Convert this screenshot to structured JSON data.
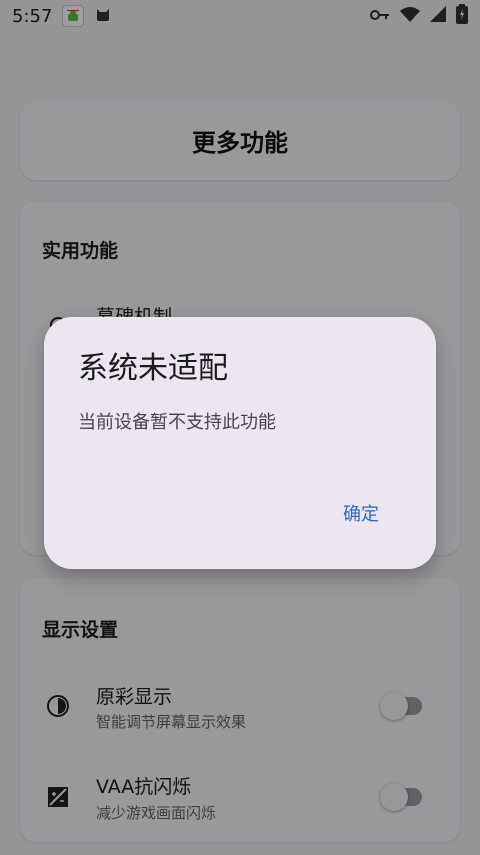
{
  "status_bar": {
    "time": "5:57"
  },
  "page": {
    "title": "更多功能"
  },
  "practical_section": {
    "title": "实用功能",
    "items": [
      {
        "label": "募碑机制",
        "icon": "person-outline-icon"
      }
    ]
  },
  "display_section": {
    "title": "显示设置",
    "items": [
      {
        "label": "原彩显示",
        "subtitle": "智能调节屏幕显示效果",
        "icon": "contrast-icon",
        "enabled": false
      },
      {
        "label": "VAA抗闪烁",
        "subtitle": "减少游戏画面闪烁",
        "icon": "flicker-icon",
        "enabled": false
      }
    ]
  },
  "dialog": {
    "title": "系统未适配",
    "message": "当前设备暂不支持此功能",
    "ok_label": "确定"
  },
  "colors": {
    "accent": "#2e66c9",
    "dialog_bg": "#ece6f0"
  }
}
